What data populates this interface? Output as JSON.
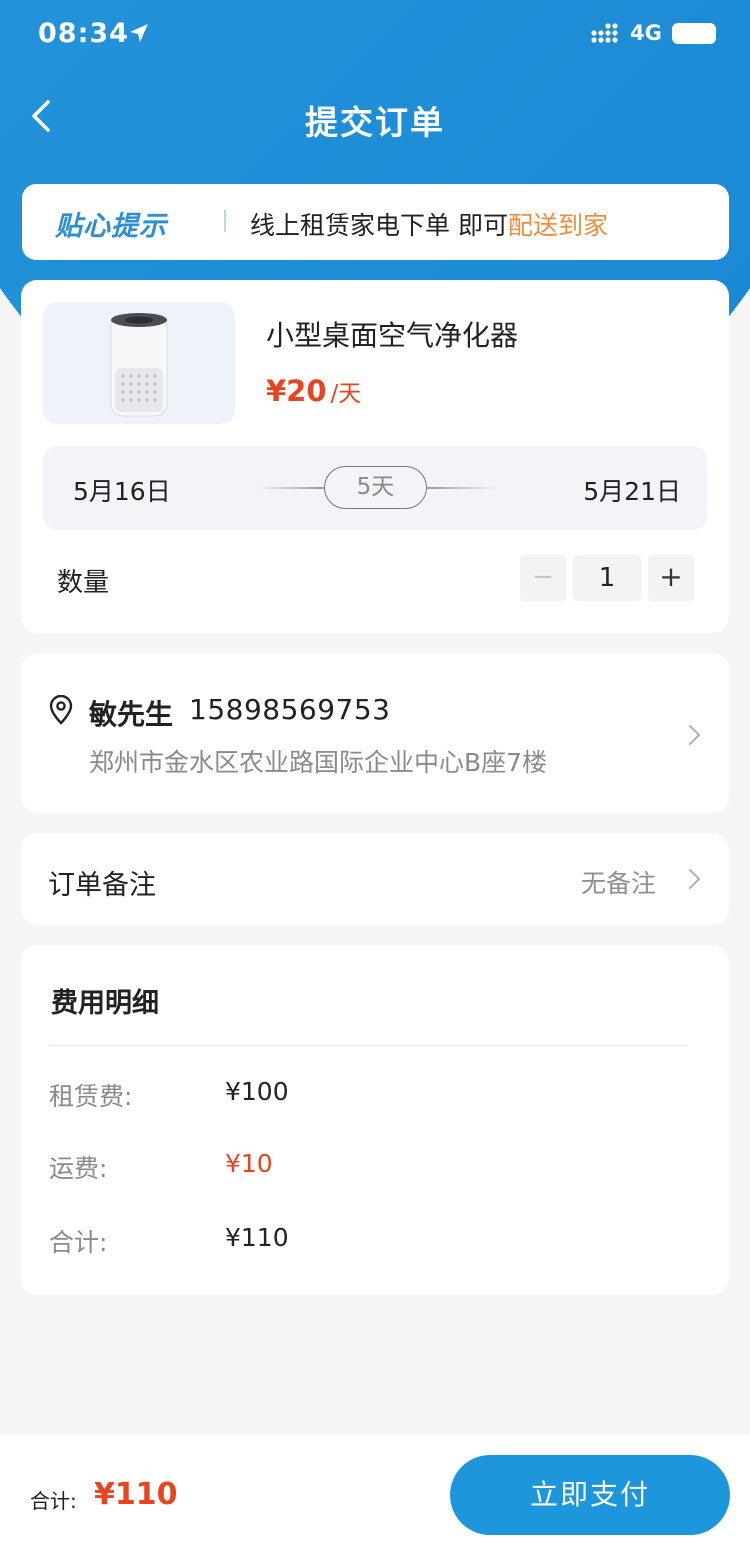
{
  "status_bar": {
    "time": "08:34",
    "network": "4G"
  },
  "nav": {
    "title": "提交订单"
  },
  "tip": {
    "tag": "贴心提示",
    "text": "线上租赁家电下单 即可",
    "highlight": "配送到家"
  },
  "product": {
    "name": "小型桌面空气净化器",
    "price": "¥20",
    "unit": "/天",
    "start_date": "5月16日",
    "end_date": "5月21日",
    "duration": "5天",
    "quantity_label": "数量",
    "quantity": "1",
    "minus": "−",
    "plus": "+"
  },
  "address": {
    "name": "敏先生",
    "phone": "15898569753",
    "detail": "郑州市金水区农业路国际企业中心B座7楼"
  },
  "remark": {
    "label": "订单备注",
    "value": "无备注"
  },
  "fees": {
    "title": "费用明细",
    "items": [
      {
        "label": "租赁费:",
        "value": "¥100"
      },
      {
        "label": "运费:",
        "value": "¥10"
      },
      {
        "label": "合计:",
        "value": "¥110"
      }
    ]
  },
  "footer": {
    "total_label": "合计:",
    "total_value": "¥110",
    "pay_button": "立即支付"
  },
  "colors": {
    "primary": "#1d96dc",
    "price_red": "#e8441f",
    "tip_orange": "#f08c3e",
    "tip_blue": "#2a8fd6"
  }
}
